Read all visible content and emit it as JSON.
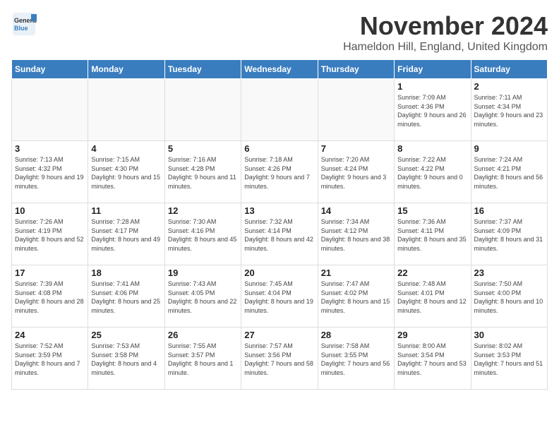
{
  "header": {
    "logo_general": "General",
    "logo_blue": "Blue",
    "month": "November 2024",
    "location": "Hameldon Hill, England, United Kingdom"
  },
  "days_of_week": [
    "Sunday",
    "Monday",
    "Tuesday",
    "Wednesday",
    "Thursday",
    "Friday",
    "Saturday"
  ],
  "weeks": [
    [
      {
        "day": "",
        "info": ""
      },
      {
        "day": "",
        "info": ""
      },
      {
        "day": "",
        "info": ""
      },
      {
        "day": "",
        "info": ""
      },
      {
        "day": "",
        "info": ""
      },
      {
        "day": "1",
        "info": "Sunrise: 7:09 AM\nSunset: 4:36 PM\nDaylight: 9 hours and 26 minutes."
      },
      {
        "day": "2",
        "info": "Sunrise: 7:11 AM\nSunset: 4:34 PM\nDaylight: 9 hours and 23 minutes."
      }
    ],
    [
      {
        "day": "3",
        "info": "Sunrise: 7:13 AM\nSunset: 4:32 PM\nDaylight: 9 hours and 19 minutes."
      },
      {
        "day": "4",
        "info": "Sunrise: 7:15 AM\nSunset: 4:30 PM\nDaylight: 9 hours and 15 minutes."
      },
      {
        "day": "5",
        "info": "Sunrise: 7:16 AM\nSunset: 4:28 PM\nDaylight: 9 hours and 11 minutes."
      },
      {
        "day": "6",
        "info": "Sunrise: 7:18 AM\nSunset: 4:26 PM\nDaylight: 9 hours and 7 minutes."
      },
      {
        "day": "7",
        "info": "Sunrise: 7:20 AM\nSunset: 4:24 PM\nDaylight: 9 hours and 3 minutes."
      },
      {
        "day": "8",
        "info": "Sunrise: 7:22 AM\nSunset: 4:22 PM\nDaylight: 9 hours and 0 minutes."
      },
      {
        "day": "9",
        "info": "Sunrise: 7:24 AM\nSunset: 4:21 PM\nDaylight: 8 hours and 56 minutes."
      }
    ],
    [
      {
        "day": "10",
        "info": "Sunrise: 7:26 AM\nSunset: 4:19 PM\nDaylight: 8 hours and 52 minutes."
      },
      {
        "day": "11",
        "info": "Sunrise: 7:28 AM\nSunset: 4:17 PM\nDaylight: 8 hours and 49 minutes."
      },
      {
        "day": "12",
        "info": "Sunrise: 7:30 AM\nSunset: 4:16 PM\nDaylight: 8 hours and 45 minutes."
      },
      {
        "day": "13",
        "info": "Sunrise: 7:32 AM\nSunset: 4:14 PM\nDaylight: 8 hours and 42 minutes."
      },
      {
        "day": "14",
        "info": "Sunrise: 7:34 AM\nSunset: 4:12 PM\nDaylight: 8 hours and 38 minutes."
      },
      {
        "day": "15",
        "info": "Sunrise: 7:36 AM\nSunset: 4:11 PM\nDaylight: 8 hours and 35 minutes."
      },
      {
        "day": "16",
        "info": "Sunrise: 7:37 AM\nSunset: 4:09 PM\nDaylight: 8 hours and 31 minutes."
      }
    ],
    [
      {
        "day": "17",
        "info": "Sunrise: 7:39 AM\nSunset: 4:08 PM\nDaylight: 8 hours and 28 minutes."
      },
      {
        "day": "18",
        "info": "Sunrise: 7:41 AM\nSunset: 4:06 PM\nDaylight: 8 hours and 25 minutes."
      },
      {
        "day": "19",
        "info": "Sunrise: 7:43 AM\nSunset: 4:05 PM\nDaylight: 8 hours and 22 minutes."
      },
      {
        "day": "20",
        "info": "Sunrise: 7:45 AM\nSunset: 4:04 PM\nDaylight: 8 hours and 19 minutes."
      },
      {
        "day": "21",
        "info": "Sunrise: 7:47 AM\nSunset: 4:02 PM\nDaylight: 8 hours and 15 minutes."
      },
      {
        "day": "22",
        "info": "Sunrise: 7:48 AM\nSunset: 4:01 PM\nDaylight: 8 hours and 12 minutes."
      },
      {
        "day": "23",
        "info": "Sunrise: 7:50 AM\nSunset: 4:00 PM\nDaylight: 8 hours and 10 minutes."
      }
    ],
    [
      {
        "day": "24",
        "info": "Sunrise: 7:52 AM\nSunset: 3:59 PM\nDaylight: 8 hours and 7 minutes."
      },
      {
        "day": "25",
        "info": "Sunrise: 7:53 AM\nSunset: 3:58 PM\nDaylight: 8 hours and 4 minutes."
      },
      {
        "day": "26",
        "info": "Sunrise: 7:55 AM\nSunset: 3:57 PM\nDaylight: 8 hours and 1 minute."
      },
      {
        "day": "27",
        "info": "Sunrise: 7:57 AM\nSunset: 3:56 PM\nDaylight: 7 hours and 58 minutes."
      },
      {
        "day": "28",
        "info": "Sunrise: 7:58 AM\nSunset: 3:55 PM\nDaylight: 7 hours and 56 minutes."
      },
      {
        "day": "29",
        "info": "Sunrise: 8:00 AM\nSunset: 3:54 PM\nDaylight: 7 hours and 53 minutes."
      },
      {
        "day": "30",
        "info": "Sunrise: 8:02 AM\nSunset: 3:53 PM\nDaylight: 7 hours and 51 minutes."
      }
    ]
  ]
}
